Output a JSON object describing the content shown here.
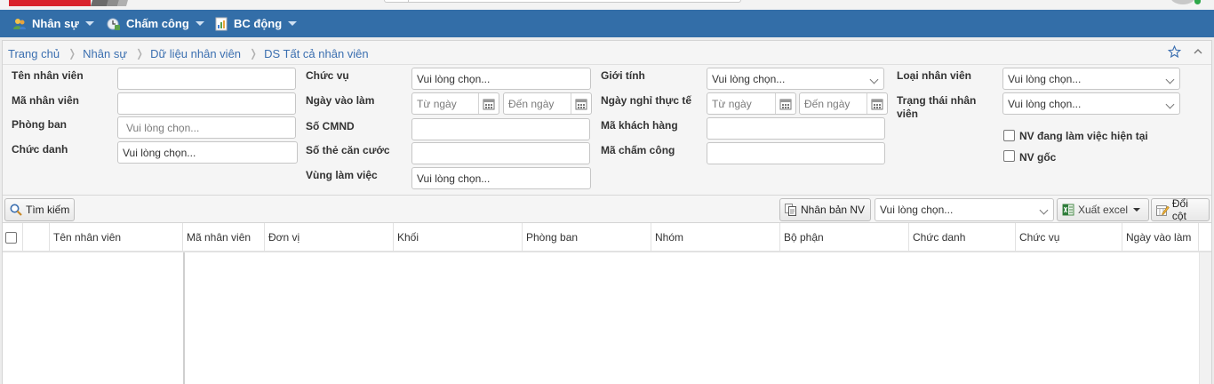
{
  "menu": {
    "items": [
      {
        "label": "Nhân sự",
        "icon": "users-icon"
      },
      {
        "label": "Chấm công",
        "icon": "timesheet-icon"
      },
      {
        "label": "BC động",
        "icon": "report-icon"
      }
    ]
  },
  "breadcrumb": [
    "Trang chủ",
    "Nhân sự",
    "Dữ liệu nhân viên",
    "DS Tất cả nhân viên"
  ],
  "form": {
    "ten_nhan_vien": {
      "label": "Tên nhân viên",
      "value": ""
    },
    "ma_nhan_vien": {
      "label": "Mã nhân viên",
      "value": ""
    },
    "phong_ban": {
      "label": "Phòng ban",
      "placeholder": "Vui lòng chọn..."
    },
    "chuc_danh": {
      "label": "Chức danh",
      "value": "Vui lòng chọn..."
    },
    "chuc_vu": {
      "label": "Chức vụ",
      "value": "Vui lòng chọn..."
    },
    "ngay_vao_lam": {
      "label": "Ngày vào làm",
      "from": "Từ ngày",
      "to": "Đến ngày"
    },
    "so_cmnd": {
      "label": "Số CMND",
      "value": ""
    },
    "so_the_can_cuoc": {
      "label": "Số thẻ căn cước",
      "value": ""
    },
    "vung_lam_viec": {
      "label": "Vùng làm việc",
      "value": "Vui lòng chọn..."
    },
    "gioi_tinh": {
      "label": "Giới tính",
      "value": "Vui lòng chọn..."
    },
    "ngay_nghi_thuc_te": {
      "label": "Ngày nghỉ thực tế",
      "from": "Từ ngày",
      "to": "Đến ngày"
    },
    "ma_khach_hang": {
      "label": "Mã khách hàng",
      "value": ""
    },
    "ma_cham_cong": {
      "label": "Mã chấm công",
      "value": ""
    },
    "loai_nhan_vien": {
      "label": "Loại nhân viên",
      "value": "Vui lòng chọn..."
    },
    "trang_thai_nhan_vien": {
      "label_line1": "Trạng thái nhân",
      "label_line2": "viên",
      "value": "Vui lòng chọn..."
    },
    "nv_dang_lam_viec": {
      "label": "NV đang làm việc hiện tại",
      "checked": false
    },
    "nv_goc": {
      "label": "NV gốc",
      "checked": false
    }
  },
  "toolbar": {
    "search_label": "Tìm kiếm",
    "clone_label": "Nhân bản NV",
    "select_value": "Vui lòng chọn...",
    "export_label": "Xuất excel",
    "columns_label": "Đổi cột"
  },
  "grid": {
    "columns": [
      "Tên nhân viên",
      "Mã nhân viên",
      "Đơn vị",
      "Khối",
      "Phòng ban",
      "Nhóm",
      "Bộ phận",
      "Chức danh",
      "Chức vụ",
      "Ngày vào làm"
    ],
    "rows": []
  },
  "colors": {
    "menu_bg": "#336ea8",
    "link": "#3b6fb0",
    "online": "#2ea84a"
  }
}
